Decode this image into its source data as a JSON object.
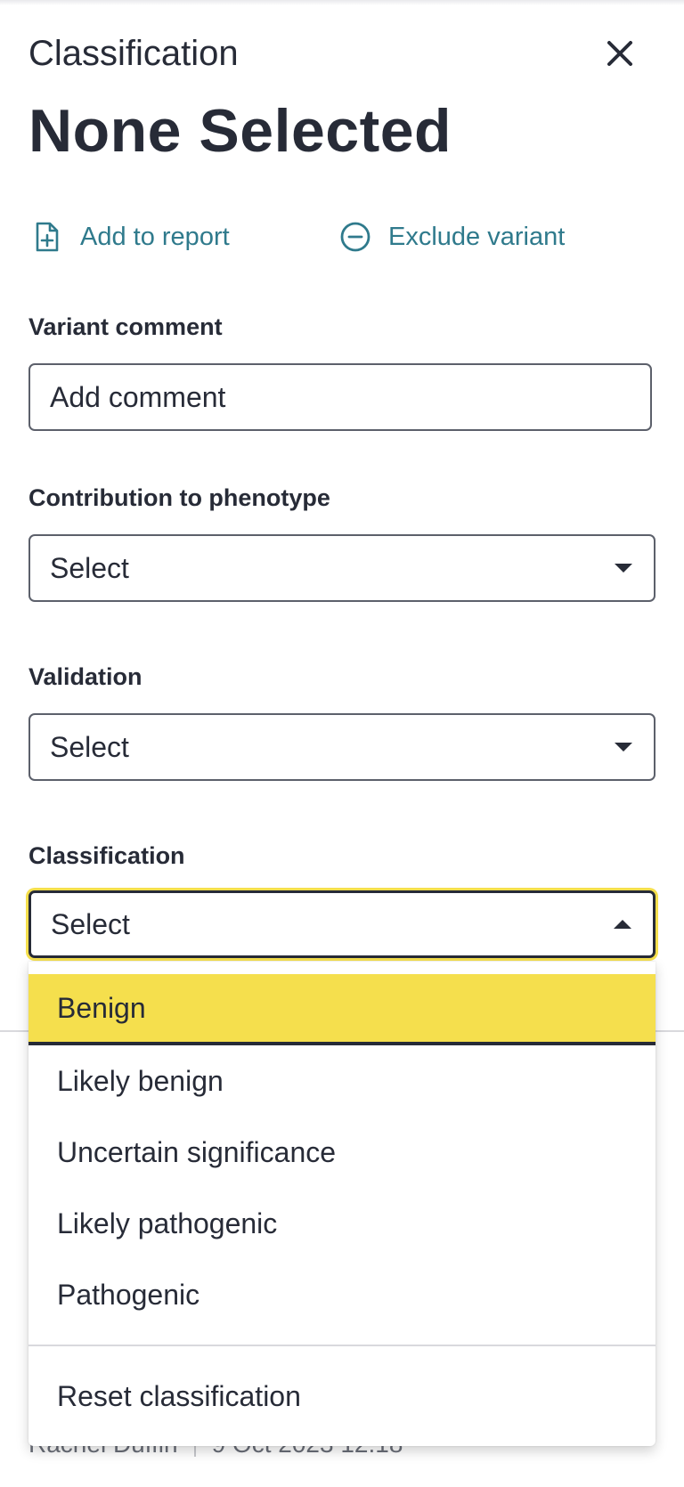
{
  "header": {
    "subtitle": "Classification",
    "title": "None Selected"
  },
  "actions": {
    "add_to_report": "Add to report",
    "exclude_variant": "Exclude variant"
  },
  "fields": {
    "variant_comment": {
      "label": "Variant comment",
      "placeholder": "Add comment"
    },
    "contribution": {
      "label": "Contribution to phenotype",
      "value": "Select"
    },
    "validation": {
      "label": "Validation",
      "value": "Select"
    },
    "classification": {
      "label": "Classification",
      "value": "Select"
    }
  },
  "dropdown": {
    "options": [
      {
        "label": "Benign",
        "highlighted": true
      },
      {
        "label": "Likely benign"
      },
      {
        "label": "Uncertain significance"
      },
      {
        "label": "Likely pathogenic"
      },
      {
        "label": "Pathogenic"
      }
    ],
    "reset_label": "Reset classification"
  },
  "footer": {
    "author": "Rachel Duffin",
    "timestamp": "9 Oct 2023 12:18"
  },
  "colors": {
    "accent_link": "#2f7a8c",
    "highlight": "#f5df4d",
    "text": "#272b37"
  },
  "icons": {
    "close": "close-icon",
    "add_to_report": "document-plus-icon",
    "exclude_variant": "circle-minus-icon",
    "select_closed": "caret-down-icon",
    "select_open": "caret-up-icon"
  }
}
